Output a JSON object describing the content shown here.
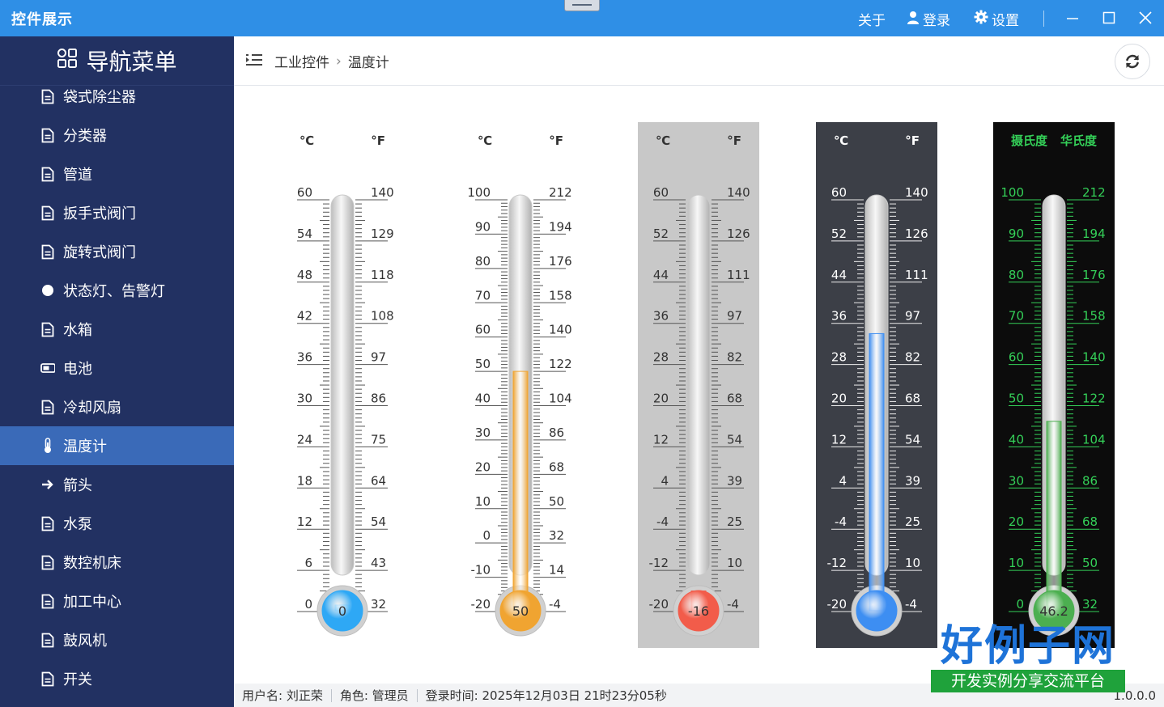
{
  "window": {
    "title": "控件展示",
    "about": "关于",
    "login": "登录",
    "settings": "设置"
  },
  "sidebar": {
    "title": "导航菜单",
    "items": [
      {
        "label": "袋式除尘器",
        "icon": "document-icon"
      },
      {
        "label": "分类器",
        "icon": "document-icon"
      },
      {
        "label": "管道",
        "icon": "document-icon"
      },
      {
        "label": "扳手式阀门",
        "icon": "document-icon"
      },
      {
        "label": "旋转式阀门",
        "icon": "document-icon"
      },
      {
        "label": "状态灯、告警灯",
        "icon": "circle-icon"
      },
      {
        "label": "水箱",
        "icon": "document-icon"
      },
      {
        "label": "电池",
        "icon": "battery-icon"
      },
      {
        "label": "冷却风扇",
        "icon": "document-icon"
      },
      {
        "label": "温度计",
        "icon": "thermometer-icon",
        "active": true
      },
      {
        "label": "箭头",
        "icon": "arrow-right-icon"
      },
      {
        "label": "水泵",
        "icon": "document-icon"
      },
      {
        "label": "数控机床",
        "icon": "document-icon"
      },
      {
        "label": "加工中心",
        "icon": "document-icon"
      },
      {
        "label": "鼓风机",
        "icon": "document-icon"
      },
      {
        "label": "开关",
        "icon": "document-icon"
      }
    ]
  },
  "breadcrumb": {
    "parent": "工业控件",
    "separator": "›",
    "current": "温度计"
  },
  "thermometers": [
    {
      "unitLeft": "℃",
      "unitRight": "°F",
      "leftLabels": [
        "60",
        "54",
        "48",
        "42",
        "36",
        "30",
        "24",
        "18",
        "12",
        "6",
        "0"
      ],
      "rightLabels": [
        "140",
        "129",
        "118",
        "108",
        "97",
        "86",
        "75",
        "64",
        "54",
        "43",
        "32"
      ],
      "min": 0,
      "max": 60,
      "value": 0,
      "valueLabel": "0",
      "fill": "#2ea8f5",
      "bg": "#ffffff",
      "scaleColor": "#555555",
      "textColor": "#333333"
    },
    {
      "unitLeft": "℃",
      "unitRight": "°F",
      "leftLabels": [
        "100",
        "90",
        "80",
        "70",
        "60",
        "50",
        "40",
        "30",
        "20",
        "10",
        "0",
        "-10",
        "-20"
      ],
      "rightLabels": [
        "212",
        "194",
        "176",
        "158",
        "140",
        "122",
        "104",
        "86",
        "68",
        "50",
        "32",
        "14",
        "-4"
      ],
      "min": -20,
      "max": 100,
      "value": 50,
      "valueLabel": "50",
      "fill": "#f0a431",
      "bg": "#ffffff",
      "scaleColor": "#555555",
      "textColor": "#333333"
    },
    {
      "unitLeft": "℃",
      "unitRight": "°F",
      "leftLabels": [
        "60",
        "52",
        "44",
        "36",
        "28",
        "20",
        "12",
        "4",
        "-4",
        "-12",
        "-20"
      ],
      "rightLabels": [
        "140",
        "126",
        "111",
        "97",
        "82",
        "68",
        "54",
        "39",
        "25",
        "10",
        "-4"
      ],
      "min": -20,
      "max": 60,
      "value": -16,
      "valueLabel": "-16",
      "fill": "#f25c4a",
      "bg": "#c8c8c8",
      "scaleColor": "#555555",
      "textColor": "#333333"
    },
    {
      "unitLeft": "℃",
      "unitRight": "°F",
      "leftLabels": [
        "60",
        "52",
        "44",
        "36",
        "28",
        "20",
        "12",
        "4",
        "-4",
        "-12",
        "-20"
      ],
      "rightLabels": [
        "140",
        "126",
        "111",
        "97",
        "82",
        "68",
        "54",
        "39",
        "25",
        "10",
        "-4"
      ],
      "min": -20,
      "max": 60,
      "value": 34,
      "valueLabel": "",
      "fill": "#3d8ef2",
      "bg": "#3c3f47",
      "scaleColor": "#eeeeee",
      "textColor": "#ffffff"
    },
    {
      "unitLeft": "摄氏度",
      "unitRight": "华氏度",
      "leftLabels": [
        "100",
        "90",
        "80",
        "70",
        "60",
        "50",
        "40",
        "30",
        "20",
        "10",
        "0"
      ],
      "rightLabels": [
        "212",
        "194",
        "176",
        "158",
        "140",
        "122",
        "104",
        "86",
        "68",
        "50",
        "32"
      ],
      "min": 0,
      "max": 100,
      "value": 46.2,
      "valueLabel": "46.2",
      "fill": "#4caf50",
      "bg": "#0c0c0c",
      "scaleColor": "#34d058",
      "textColor": "#34d058"
    }
  ],
  "status": {
    "user": "用户名: 刘正荣",
    "role": "角色: 管理员",
    "loginTime": "登录时间: 2025年12月03日 21时23分05秒",
    "version": "1.0.0.0"
  },
  "watermark": {
    "site": "好例子网",
    "slogan": "开发实例分享交流平台"
  }
}
